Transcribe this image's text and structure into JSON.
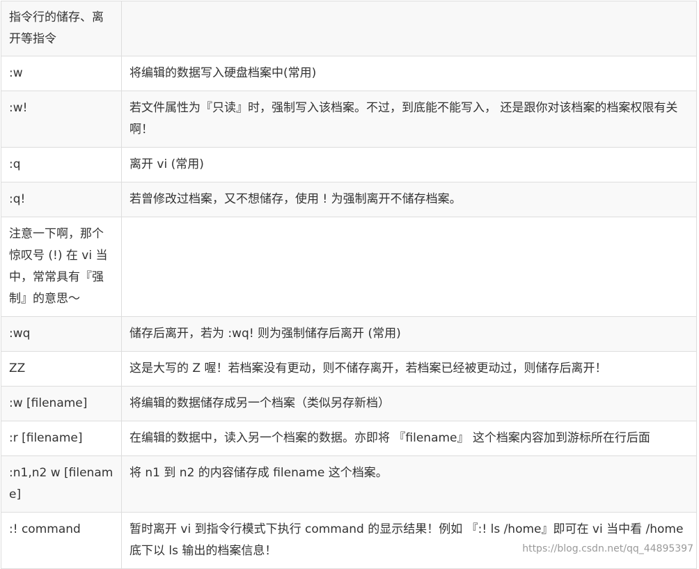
{
  "table": {
    "header": {
      "col1": "指令行的储存、离开等指令",
      "col2": ""
    },
    "rows": [
      {
        "cmd": ":w",
        "desc": "将编辑的数据写入硬盘档案中(常用)"
      },
      {
        "cmd": ":w!",
        "desc": "若文件属性为『只读』时，强制写入该档案。不过，到底能不能写入， 还是跟你对该档案的档案权限有关啊！"
      },
      {
        "cmd": ":q",
        "desc": "离开 vi (常用)"
      },
      {
        "cmd": ":q!",
        "desc": "若曾修改过档案，又不想储存，使用 ! 为强制离开不储存档案。"
      },
      {
        "cmd": "注意一下啊，那个惊叹号 (!) 在 vi 当中，常常具有『强制』的意思～",
        "desc": ""
      },
      {
        "cmd": ":wq",
        "desc": "储存后离开，若为 :wq! 则为强制储存后离开 (常用)"
      },
      {
        "cmd": "ZZ",
        "desc": "这是大写的 Z 喔！若档案没有更动，则不储存离开，若档案已经被更动过，则储存后离开！"
      },
      {
        "cmd": ":w [filename]",
        "desc": "将编辑的数据储存成另一个档案（类似另存新档）"
      },
      {
        "cmd": ":r [filename]",
        "desc": "在编辑的数据中，读入另一个档案的数据。亦即将 『filename』 这个档案内容加到游标所在行后面"
      },
      {
        "cmd": ":n1,n2 w [filename]",
        "desc": "将 n1 到 n2 的内容储存成 filename 这个档案。"
      },
      {
        "cmd": ":! command",
        "desc": "暂时离开 vi 到指令行模式下执行 command 的显示结果！例如 『:! ls /home』即可在 vi 当中看 /home 底下以 ls 输出的档案信息！"
      }
    ]
  },
  "watermark": "https://blog.csdn.net/qq_44895397"
}
